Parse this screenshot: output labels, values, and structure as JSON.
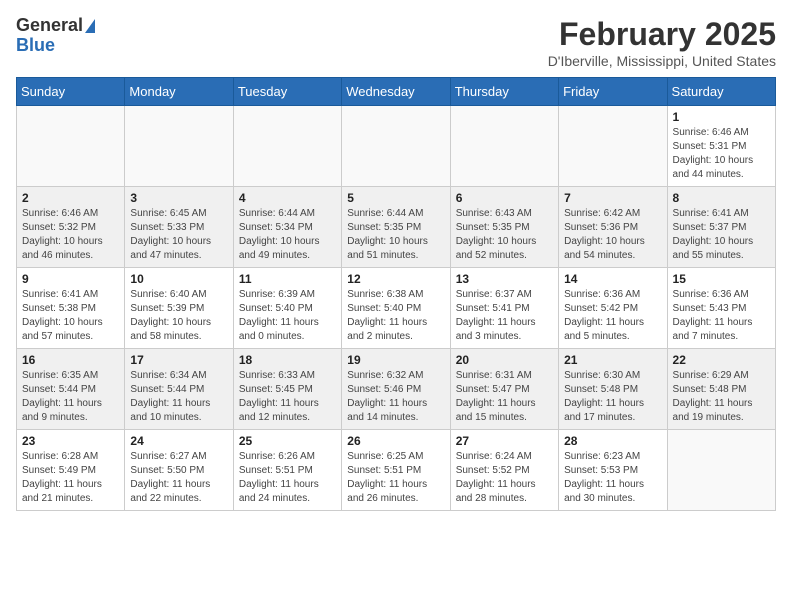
{
  "header": {
    "logo_line1": "General",
    "logo_line2": "Blue",
    "title": "February 2025",
    "subtitle": "D'Iberville, Mississippi, United States"
  },
  "days_of_week": [
    "Sunday",
    "Monday",
    "Tuesday",
    "Wednesday",
    "Thursday",
    "Friday",
    "Saturday"
  ],
  "weeks": [
    [
      {
        "day": "",
        "info": ""
      },
      {
        "day": "",
        "info": ""
      },
      {
        "day": "",
        "info": ""
      },
      {
        "day": "",
        "info": ""
      },
      {
        "day": "",
        "info": ""
      },
      {
        "day": "",
        "info": ""
      },
      {
        "day": "1",
        "info": "Sunrise: 6:46 AM\nSunset: 5:31 PM\nDaylight: 10 hours and 44 minutes."
      }
    ],
    [
      {
        "day": "2",
        "info": "Sunrise: 6:46 AM\nSunset: 5:32 PM\nDaylight: 10 hours and 46 minutes."
      },
      {
        "day": "3",
        "info": "Sunrise: 6:45 AM\nSunset: 5:33 PM\nDaylight: 10 hours and 47 minutes."
      },
      {
        "day": "4",
        "info": "Sunrise: 6:44 AM\nSunset: 5:34 PM\nDaylight: 10 hours and 49 minutes."
      },
      {
        "day": "5",
        "info": "Sunrise: 6:44 AM\nSunset: 5:35 PM\nDaylight: 10 hours and 51 minutes."
      },
      {
        "day": "6",
        "info": "Sunrise: 6:43 AM\nSunset: 5:35 PM\nDaylight: 10 hours and 52 minutes."
      },
      {
        "day": "7",
        "info": "Sunrise: 6:42 AM\nSunset: 5:36 PM\nDaylight: 10 hours and 54 minutes."
      },
      {
        "day": "8",
        "info": "Sunrise: 6:41 AM\nSunset: 5:37 PM\nDaylight: 10 hours and 55 minutes."
      }
    ],
    [
      {
        "day": "9",
        "info": "Sunrise: 6:41 AM\nSunset: 5:38 PM\nDaylight: 10 hours and 57 minutes."
      },
      {
        "day": "10",
        "info": "Sunrise: 6:40 AM\nSunset: 5:39 PM\nDaylight: 10 hours and 58 minutes."
      },
      {
        "day": "11",
        "info": "Sunrise: 6:39 AM\nSunset: 5:40 PM\nDaylight: 11 hours and 0 minutes."
      },
      {
        "day": "12",
        "info": "Sunrise: 6:38 AM\nSunset: 5:40 PM\nDaylight: 11 hours and 2 minutes."
      },
      {
        "day": "13",
        "info": "Sunrise: 6:37 AM\nSunset: 5:41 PM\nDaylight: 11 hours and 3 minutes."
      },
      {
        "day": "14",
        "info": "Sunrise: 6:36 AM\nSunset: 5:42 PM\nDaylight: 11 hours and 5 minutes."
      },
      {
        "day": "15",
        "info": "Sunrise: 6:36 AM\nSunset: 5:43 PM\nDaylight: 11 hours and 7 minutes."
      }
    ],
    [
      {
        "day": "16",
        "info": "Sunrise: 6:35 AM\nSunset: 5:44 PM\nDaylight: 11 hours and 9 minutes."
      },
      {
        "day": "17",
        "info": "Sunrise: 6:34 AM\nSunset: 5:44 PM\nDaylight: 11 hours and 10 minutes."
      },
      {
        "day": "18",
        "info": "Sunrise: 6:33 AM\nSunset: 5:45 PM\nDaylight: 11 hours and 12 minutes."
      },
      {
        "day": "19",
        "info": "Sunrise: 6:32 AM\nSunset: 5:46 PM\nDaylight: 11 hours and 14 minutes."
      },
      {
        "day": "20",
        "info": "Sunrise: 6:31 AM\nSunset: 5:47 PM\nDaylight: 11 hours and 15 minutes."
      },
      {
        "day": "21",
        "info": "Sunrise: 6:30 AM\nSunset: 5:48 PM\nDaylight: 11 hours and 17 minutes."
      },
      {
        "day": "22",
        "info": "Sunrise: 6:29 AM\nSunset: 5:48 PM\nDaylight: 11 hours and 19 minutes."
      }
    ],
    [
      {
        "day": "23",
        "info": "Sunrise: 6:28 AM\nSunset: 5:49 PM\nDaylight: 11 hours and 21 minutes."
      },
      {
        "day": "24",
        "info": "Sunrise: 6:27 AM\nSunset: 5:50 PM\nDaylight: 11 hours and 22 minutes."
      },
      {
        "day": "25",
        "info": "Sunrise: 6:26 AM\nSunset: 5:51 PM\nDaylight: 11 hours and 24 minutes."
      },
      {
        "day": "26",
        "info": "Sunrise: 6:25 AM\nSunset: 5:51 PM\nDaylight: 11 hours and 26 minutes."
      },
      {
        "day": "27",
        "info": "Sunrise: 6:24 AM\nSunset: 5:52 PM\nDaylight: 11 hours and 28 minutes."
      },
      {
        "day": "28",
        "info": "Sunrise: 6:23 AM\nSunset: 5:53 PM\nDaylight: 11 hours and 30 minutes."
      },
      {
        "day": "",
        "info": ""
      }
    ]
  ]
}
